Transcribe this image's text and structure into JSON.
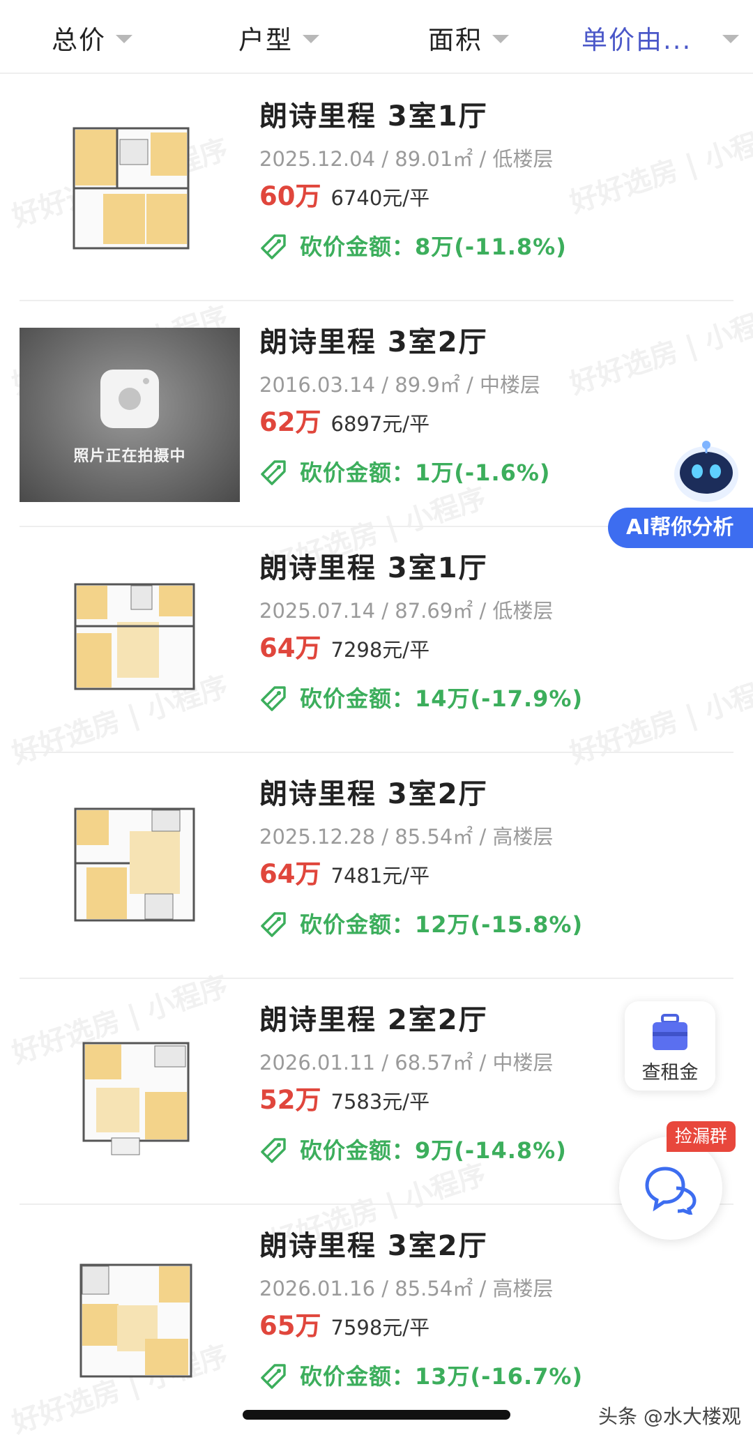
{
  "filters": [
    {
      "label": "总价"
    },
    {
      "label": "户型"
    },
    {
      "label": "面积"
    },
    {
      "label": "单价由..."
    }
  ],
  "listings": [
    {
      "title": "朗诗里程 3室1厅",
      "meta": "2025.12.04 / 89.01㎡ / 低楼层",
      "price": "60万",
      "unit_price": "6740元/平",
      "cut": "砍价金额：8万(-11.8%)",
      "thumb": "floorplan"
    },
    {
      "title": "朗诗里程 3室2厅",
      "meta": "2016.03.14 / 89.9㎡ / 中楼层",
      "price": "62万",
      "unit_price": "6897元/平",
      "cut": "砍价金额：1万(-1.6%)",
      "thumb": "photo"
    },
    {
      "title": "朗诗里程 3室1厅",
      "meta": "2025.07.14 / 87.69㎡ / 低楼层",
      "price": "64万",
      "unit_price": "7298元/平",
      "cut": "砍价金额：14万(-17.9%)",
      "thumb": "floorplan"
    },
    {
      "title": "朗诗里程 3室2厅",
      "meta": "2025.12.28 / 85.54㎡ / 高楼层",
      "price": "64万",
      "unit_price": "7481元/平",
      "cut": "砍价金额：12万(-15.8%)",
      "thumb": "floorplan"
    },
    {
      "title": "朗诗里程 2室2厅",
      "meta": "2026.01.11 / 68.57㎡ / 中楼层",
      "price": "52万",
      "unit_price": "7583元/平",
      "cut": "砍价金额：9万(-14.8%)",
      "thumb": "floorplan"
    },
    {
      "title": "朗诗里程 3室2厅",
      "meta": "2026.01.16 / 85.54㎡ / 高楼层",
      "price": "65万",
      "unit_price": "7598元/平",
      "cut": "砍价金额：13万(-16.7%)",
      "thumb": "floorplan"
    }
  ],
  "photo_placeholder_text": "照片正在拍摄中",
  "ai_badge": "AI帮你分析",
  "rent_button": "查租金",
  "chat_tag": "捡漏群",
  "source_mark": "头条 @水大楼观",
  "watermark": "好好选房 | 小程序",
  "colors": {
    "price": "#e0463c",
    "cut": "#3cae5c",
    "active_filter": "#4a57c8",
    "ai_badge": "#3d6df0"
  }
}
